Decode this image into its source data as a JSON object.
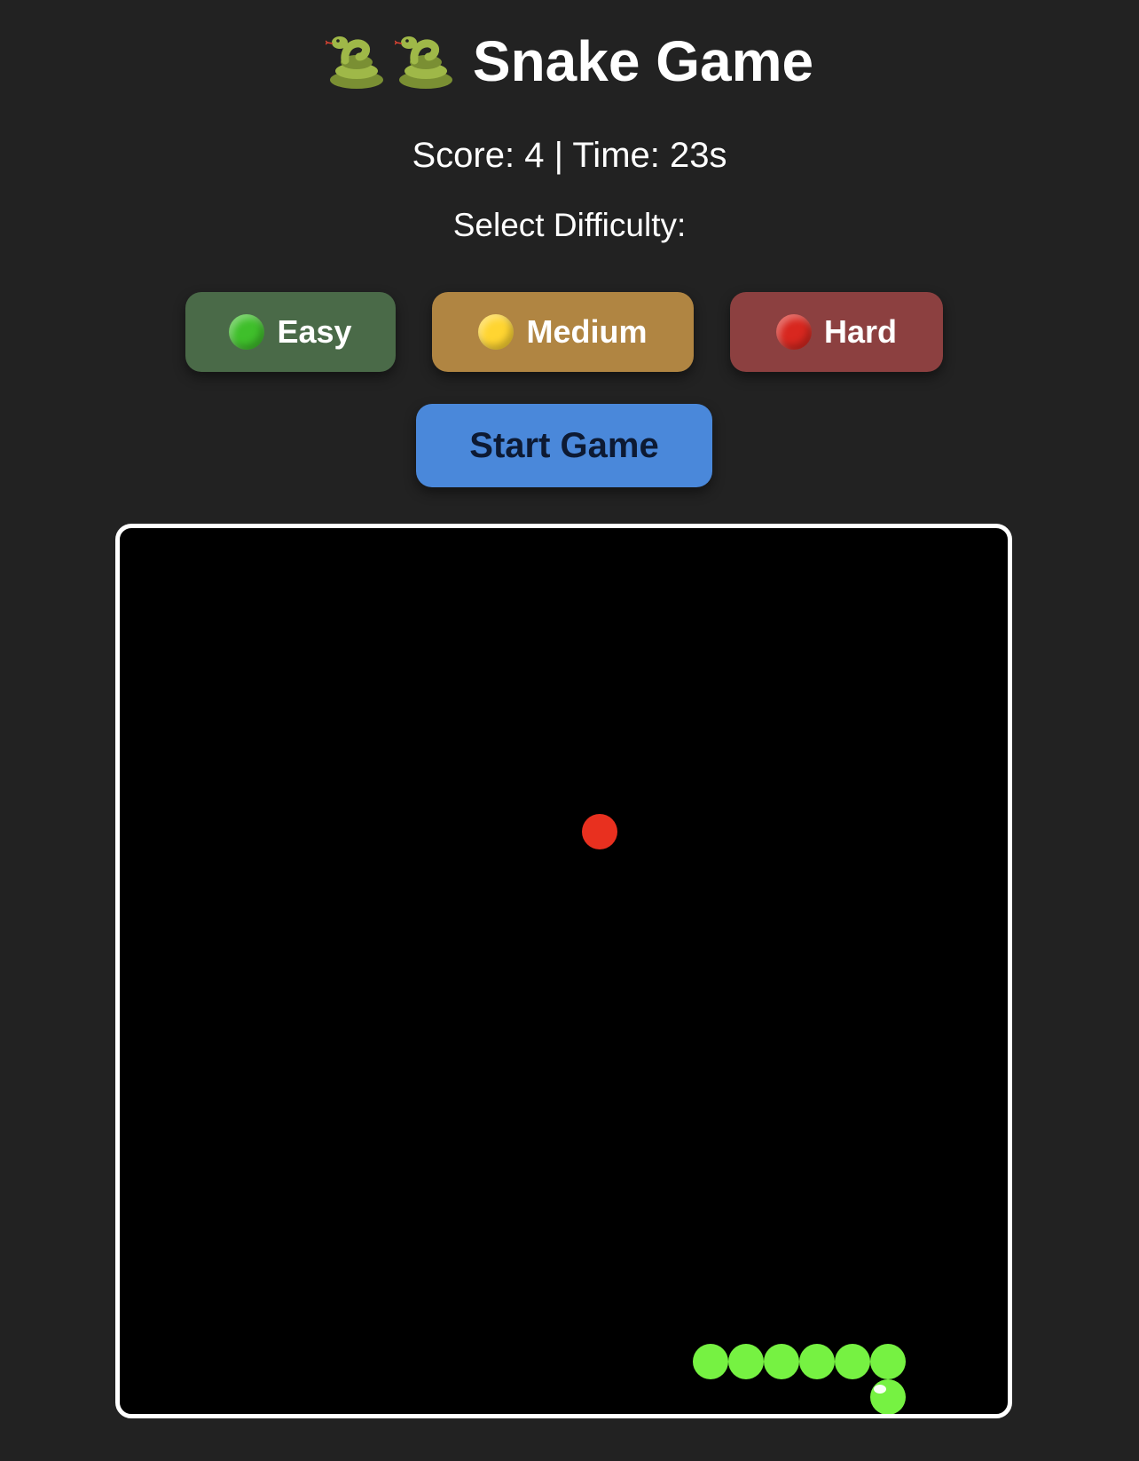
{
  "header": {
    "title": "Snake Game",
    "icons": [
      "snake-icon",
      "snake-icon"
    ]
  },
  "status": {
    "text": "Score: 4 | Time: 23s",
    "score": 4,
    "time_seconds": 23
  },
  "difficulty": {
    "label": "Select Difficulty:",
    "buttons": [
      {
        "label": "Easy",
        "icon": "green-circle-icon",
        "bg": "#4a6a48",
        "dot": "#3fbf2b"
      },
      {
        "label": "Medium",
        "icon": "yellow-circle-icon",
        "bg": "#b08542",
        "dot": "#ffd531"
      },
      {
        "label": "Hard",
        "icon": "red-circle-icon",
        "bg": "#8c4040",
        "dot": "#d8271f"
      }
    ]
  },
  "start_button": {
    "label": "Start Game",
    "bg": "#4a88da"
  },
  "board": {
    "background": "#000000",
    "border_color": "#ffffff",
    "snake_color": "#76f242",
    "food_color": "#e8301f"
  }
}
